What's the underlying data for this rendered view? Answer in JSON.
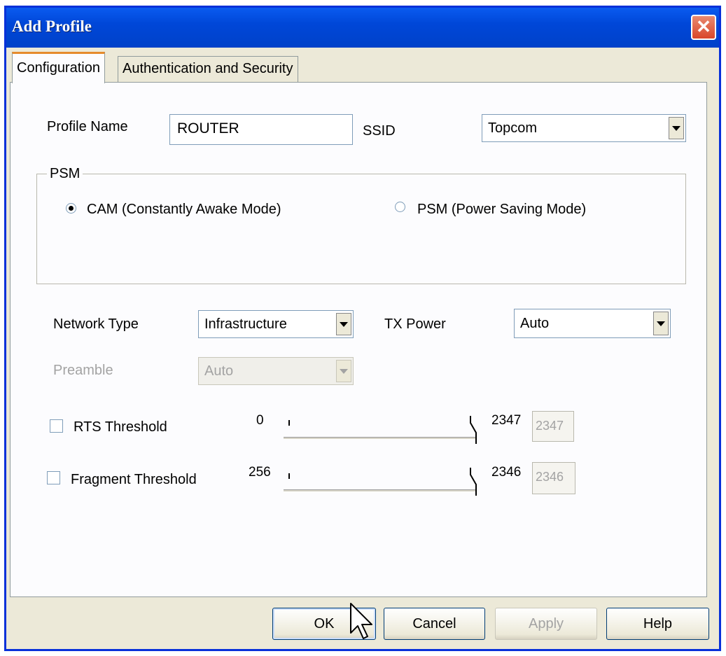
{
  "window": {
    "title": "Add Profile",
    "close_symbol": "✕"
  },
  "tabs": [
    {
      "label": "Configuration",
      "active": true
    },
    {
      "label": "Authentication and Security",
      "active": false
    }
  ],
  "profile": {
    "profile_name_label": "Profile Name",
    "profile_name_value": "ROUTER",
    "ssid_label": "SSID",
    "ssid_value": "Topcom"
  },
  "psm_group": {
    "title": "PSM",
    "cam_label": "CAM (Constantly Awake Mode)",
    "psm_label": "PSM (Power Saving Mode)",
    "selected": "cam"
  },
  "network": {
    "network_type_label": "Network Type",
    "network_type_value": "Infrastructure",
    "tx_power_label": "TX Power",
    "tx_power_value": "Auto",
    "preamble_label": "Preamble",
    "preamble_value": "Auto"
  },
  "rts": {
    "label": "RTS Threshold",
    "min": "0",
    "max": "2347",
    "value": "2347",
    "checked": false
  },
  "fragment": {
    "label": "Fragment Threshold",
    "min": "256",
    "max": "2346",
    "value": "2346",
    "checked": false
  },
  "buttons": {
    "ok": "OK",
    "cancel": "Cancel",
    "apply": "Apply",
    "help": "Help"
  }
}
